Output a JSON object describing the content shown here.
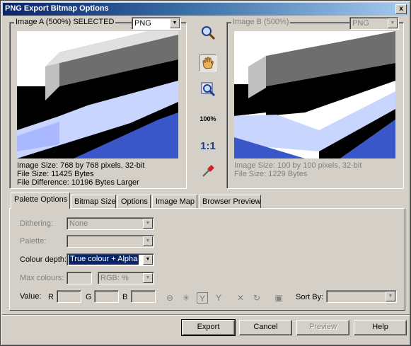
{
  "window": {
    "title": "PNG Export Bitmap Options",
    "close_glyph": "x"
  },
  "image_a": {
    "caption": "Image A (500%) SELECTED",
    "format": "PNG",
    "info": [
      "Image Size: 768 by 768 pixels, 32-bit",
      "File Size: 11425 Bytes",
      "File Difference: 10196 Bytes Larger"
    ]
  },
  "image_b": {
    "caption": "Image B (500%)",
    "format": "PNG",
    "info": [
      "Image Size: 100 by 100 pixels, 32-bit",
      "File Size: 1229 Bytes"
    ]
  },
  "tools": {
    "zoom_icon": "magnifier-icon",
    "pan_icon": "hand-icon",
    "zoom_box_icon": "zoom-to-box-icon",
    "zoom_100_label": "100%",
    "actual_pixels_label": "1:1",
    "eyedropper_icon": "eyedropper-icon"
  },
  "tabs": [
    {
      "label": "Palette Options"
    },
    {
      "label": "Bitmap Size"
    },
    {
      "label": "Options"
    },
    {
      "label": "Image Map"
    },
    {
      "label": "Browser Preview"
    }
  ],
  "palette": {
    "dithering_label": "Dithering:",
    "dithering_value": "None",
    "palette_label": "Palette:",
    "palette_value": "",
    "colour_depth_label": "Colour depth:",
    "colour_depth_value": "True colour + Alpha",
    "max_colours_label": "Max colours:",
    "max_colours_value": "",
    "colour_model_value": "RGB: %",
    "value_label": "Value:",
    "r_label": "R",
    "g_label": "G",
    "b_label": "B",
    "sort_by_label": "Sort By:",
    "sort_by_value": ""
  },
  "buttons": {
    "export": "Export",
    "cancel": "Cancel",
    "preview": "Preview",
    "help": "Help"
  },
  "colors": {
    "title_gradient_start": "#0a246a",
    "face": "#d4d0c8",
    "selection": "#0a246a"
  }
}
